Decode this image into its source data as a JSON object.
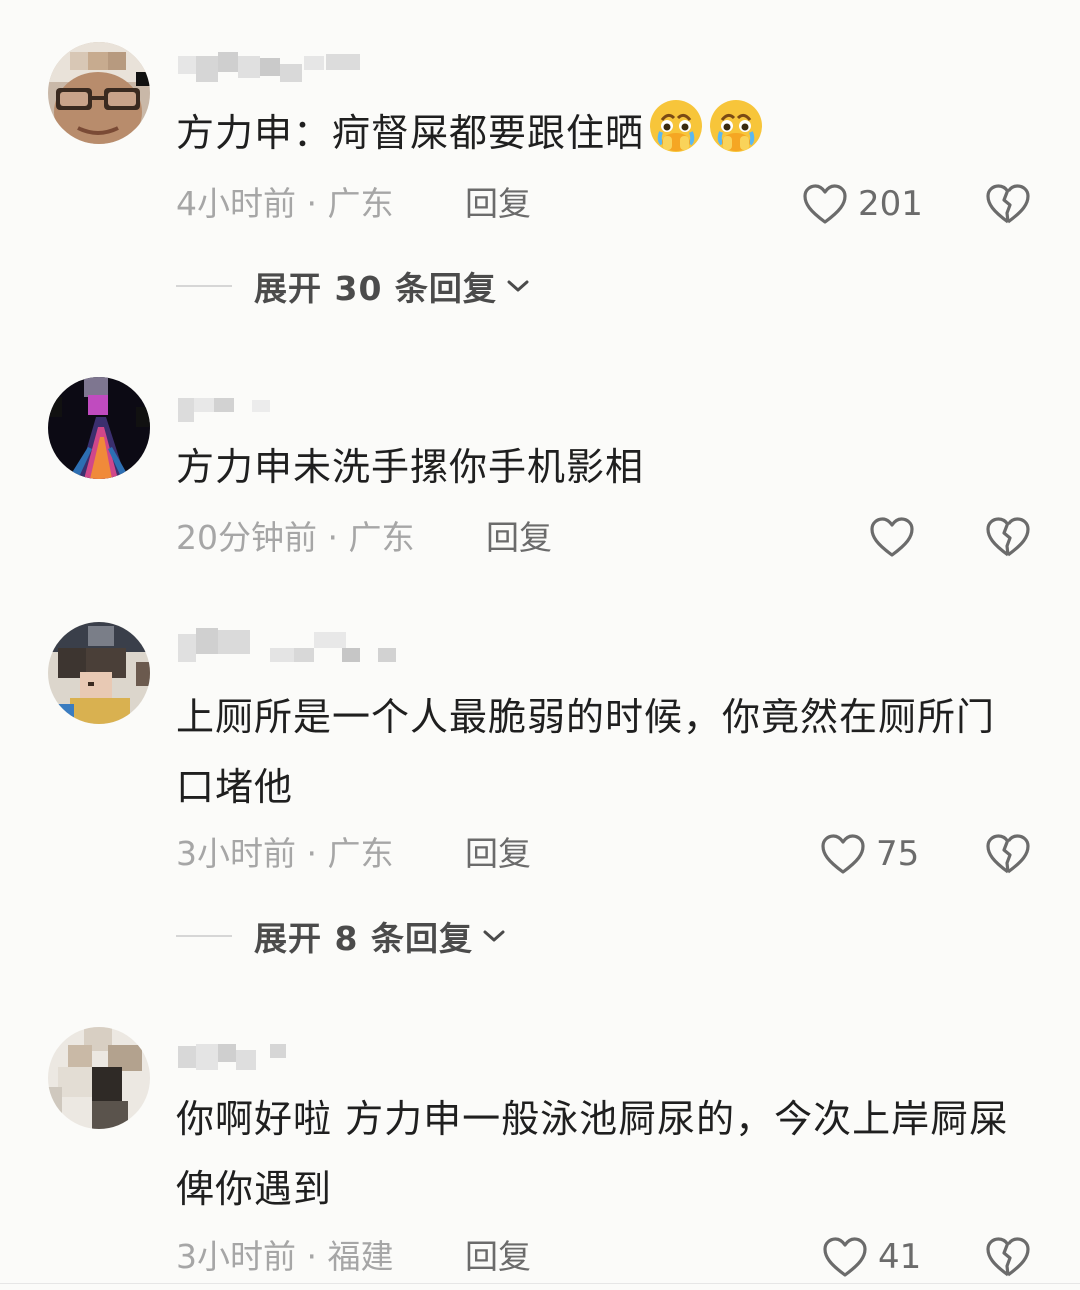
{
  "comments": [
    {
      "text": "方力申：疴督屎都要跟住晒",
      "emoji": [
        "crying-pleading-face",
        "crying-pleading-face"
      ],
      "time_location": "4小时前 · 广东",
      "reply_label": "回复",
      "likes": "201",
      "expand_label": "展开 30 条回复"
    },
    {
      "text": "方力申未洗手摞你手机影相",
      "time_location": "20分钟前 · 广东",
      "reply_label": "回复",
      "likes": ""
    },
    {
      "text": "上厕所是一个人最脆弱的时候，你竟然在厕所门口堵他",
      "time_location": "3小时前 · 广东",
      "reply_label": "回复",
      "likes": "75",
      "expand_label": "展开 8 条回复"
    },
    {
      "text": "你啊好啦 方力申一般泳池屙尿的，今次上岸屙屎俾你遇到",
      "time_location": "3小时前 · 福建",
      "reply_label": "回复",
      "likes": "41"
    }
  ],
  "icons": {
    "like": "heart-outline-icon",
    "dislike": "broken-heart-icon",
    "expand": "chevron-down-icon"
  },
  "colors": {
    "background": "#fbfbf9",
    "text": "#1f1f1f",
    "meta": "#a6a6a6",
    "action": "#6b6b6b"
  }
}
